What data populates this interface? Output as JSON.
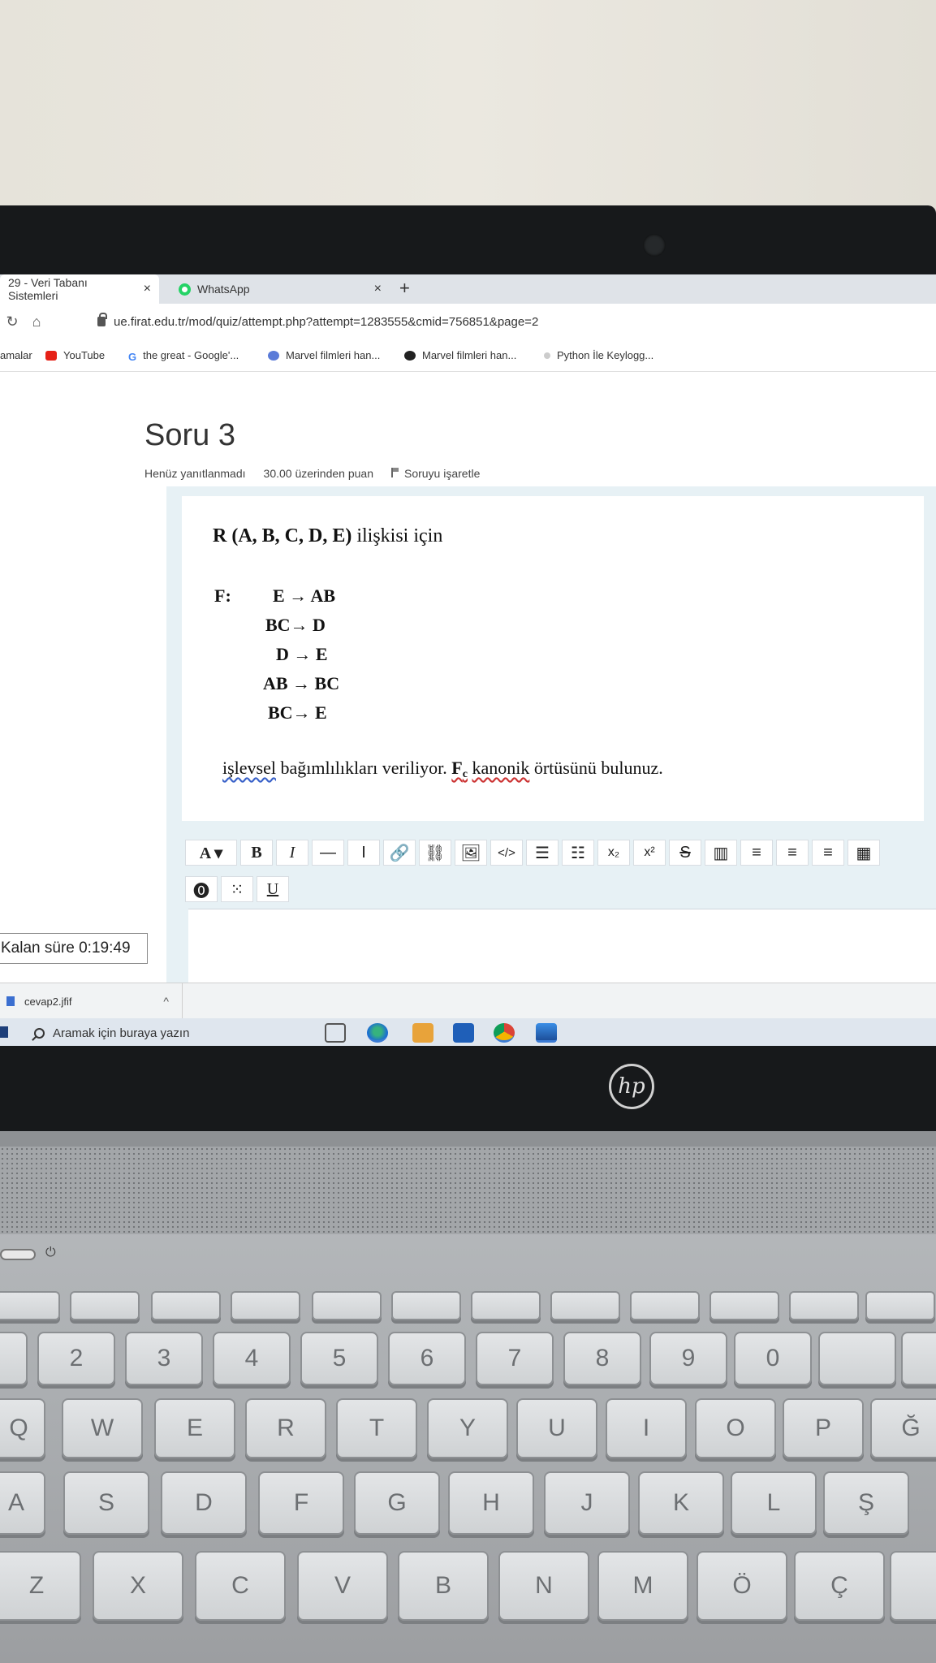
{
  "browser": {
    "tabs": [
      {
        "label": "29 - Veri Tabanı Sistemleri",
        "close": "×"
      },
      {
        "label": "WhatsApp",
        "close": "×"
      }
    ],
    "new_tab": "+",
    "address": "ue.firat.edu.tr/mod/quiz/attempt.php?attempt=1283555&cmid=756851&page=2",
    "bookmarks": [
      {
        "label": "amalar"
      },
      {
        "label": "YouTube",
        "color": "#e62117"
      },
      {
        "label": "the great - Google'...",
        "color": "#4285f4"
      },
      {
        "label": "Marvel filmleri han...",
        "color": "#5a7bd8"
      },
      {
        "label": "Marvel filmleri han...",
        "color": "#222222"
      },
      {
        "label": "Python İle Keylogg...",
        "color": "#bbbbbb"
      }
    ]
  },
  "question": {
    "title": "Soru 3",
    "status": "Henüz yanıtlanmadı",
    "points": "30.00 üzerinden puan",
    "flag": "Soruyu işaretle",
    "relation_bold": "R (A, B, C, D, E)",
    "relation_rest": " ilişkisi için",
    "f_label": "F:",
    "fds": [
      "E → AB",
      "BC→ D",
      "D → E",
      "AB → BC",
      "BC→ E"
    ],
    "text_part1": "işlevsel",
    "text_part2": " bağımlılıkları veriliyor. ",
    "text_f": "F",
    "text_fc_sub": "c",
    "text_part3": "kanonik",
    "text_part4": " örtüsünü bulunuz."
  },
  "editor": {
    "toolbar_row1": [
      "A ▾",
      "B",
      "I",
      "—",
      "I",
      "🔗",
      "⛓",
      "🖼",
      "</>",
      "☰",
      "☷",
      "x₂",
      "x²",
      "S",
      "▥",
      "≡",
      "≡",
      "≡",
      "▦"
    ],
    "toolbar_row2": [
      "⓿",
      "⁙",
      "U"
    ]
  },
  "timer": "Kalan süre 0:19:49",
  "download": {
    "filename": "cevap2.jfif",
    "chevron": "^"
  },
  "taskbar": {
    "search_placeholder": "Aramak için buraya yazın"
  },
  "brand": "hp",
  "keyboard": {
    "row_num": [
      "2",
      "3",
      "4",
      "5",
      "6",
      "7",
      "8",
      "9",
      "0"
    ],
    "row_q": [
      "Q",
      "W",
      "E",
      "R",
      "T",
      "Y",
      "U",
      "I",
      "O",
      "P",
      "Ğ"
    ],
    "row_a": [
      "A",
      "S",
      "D",
      "F",
      "G",
      "H",
      "J",
      "K",
      "L",
      "Ş"
    ],
    "row_z": [
      "Z",
      "X",
      "C",
      "V",
      "B",
      "N",
      "M",
      "Ö",
      "Ç"
    ]
  }
}
